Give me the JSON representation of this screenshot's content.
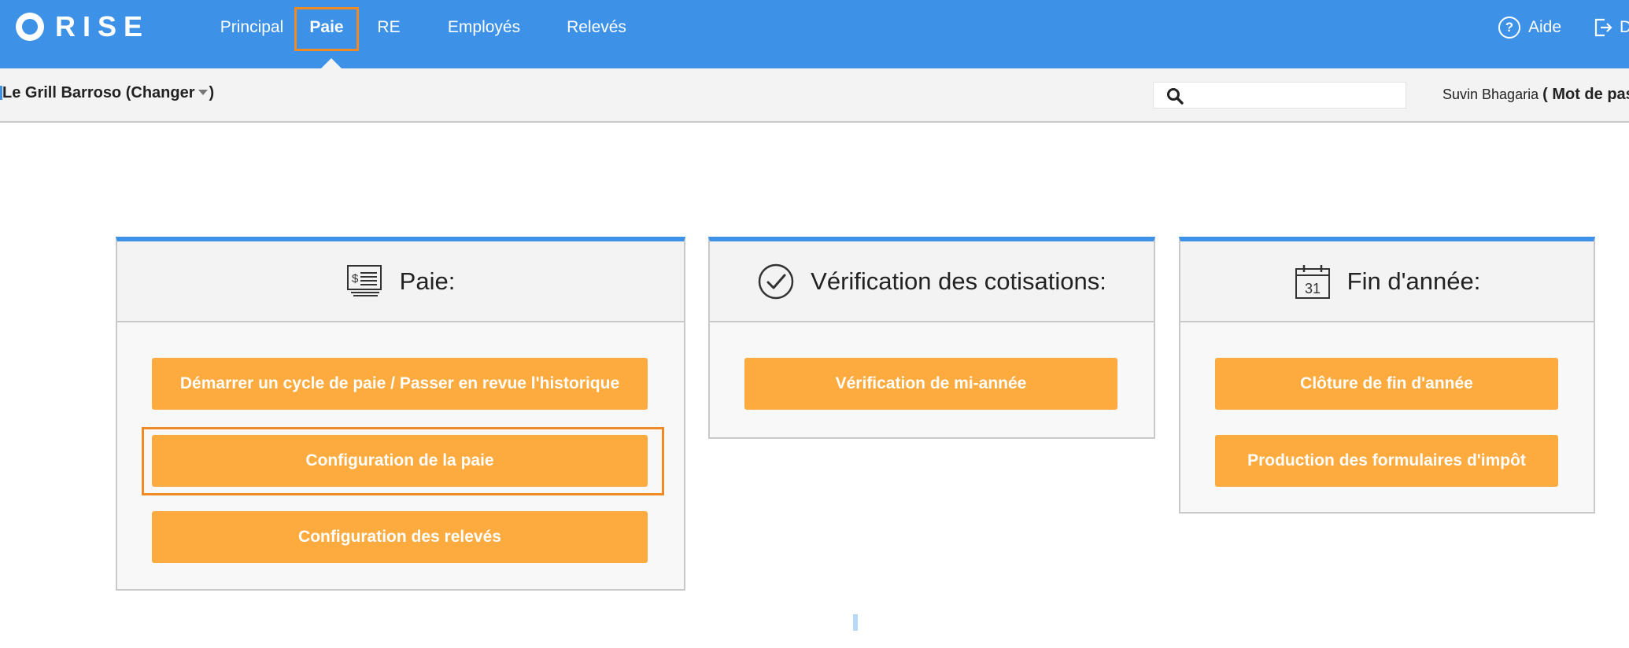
{
  "app": {
    "name": "RISE"
  },
  "nav": {
    "items": [
      {
        "label": "Principal"
      },
      {
        "label": "Paie"
      },
      {
        "label": "RE"
      },
      {
        "label": "Employés"
      },
      {
        "label": "Relevés"
      }
    ],
    "active": "Paie",
    "help_label": "Aide",
    "logout_label": "D"
  },
  "subbar": {
    "company_name": "Le Grill Barroso",
    "change_label": "(Changer",
    "change_close": ")",
    "search": {
      "value": "",
      "placeholder": ""
    },
    "user_name": "Suvin Bhagaria",
    "password_label": "( Mot de pas"
  },
  "cards": {
    "payroll": {
      "title": "Paie:",
      "buttons": [
        {
          "label": "Démarrer un cycle de paie / Passer en revue l'historique"
        },
        {
          "label": "Configuration de la paie"
        },
        {
          "label": "Configuration des relevés"
        }
      ]
    },
    "contributions": {
      "title": "Vérification des cotisations:",
      "buttons": [
        {
          "label": "Vérification de mi-année"
        }
      ]
    },
    "year_end": {
      "title": "Fin d'année:",
      "calendar_day": "31",
      "buttons": [
        {
          "label": "Clôture de fin d'année"
        },
        {
          "label": "Production des formulaires d'impôt"
        }
      ]
    }
  },
  "colors": {
    "primary": "#3d92e8",
    "button": "#fdab3e",
    "highlight": "#f08a24"
  }
}
